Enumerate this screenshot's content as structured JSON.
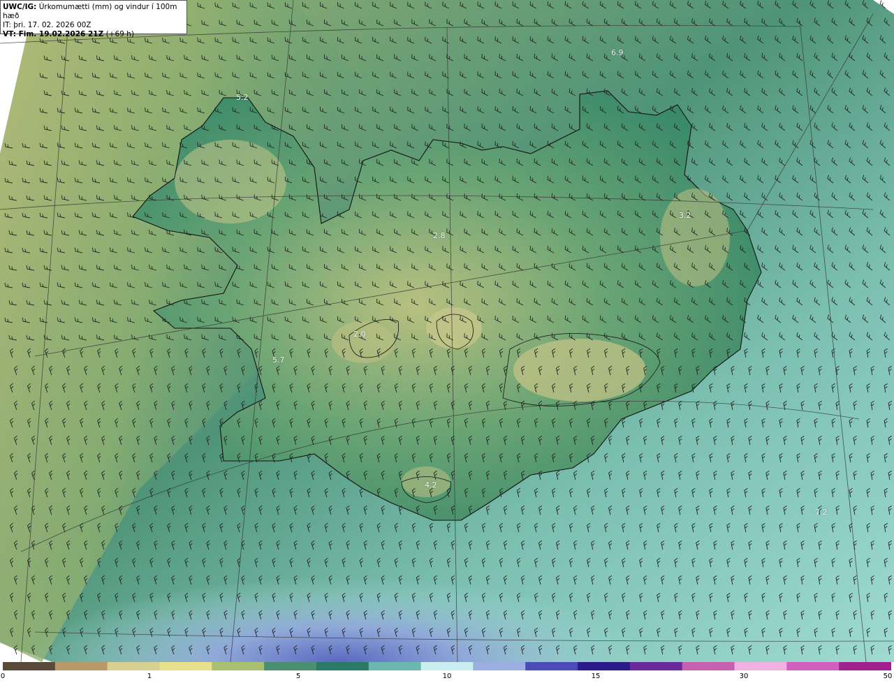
{
  "header": {
    "line1_bold": "UWC/IG:",
    "line1_text": " Úrkomumætti (mm) og vindur í 100m hæð",
    "line2": "IT: þri. 17. 02. 2026 00Z",
    "line3_bold": "VT: Fim. 19.02.2026 21Z",
    "line3_text": " (+69 h)"
  },
  "value_labels": [
    "5.2",
    "6.9",
    "2.8",
    "3.2",
    "2.0",
    "5.7",
    "4.2",
    "7.2"
  ],
  "colorbar": {
    "ticks": [
      "0",
      "1",
      "5",
      "10",
      "15",
      "30",
      "50"
    ],
    "colors": [
      "#5a4a3a",
      "#b89a6a",
      "#d8d090",
      "#e8e08a",
      "#a8c070",
      "#4a9070",
      "#2a7a68",
      "#6ab8b0",
      "#c8eef0",
      "#9aaee0",
      "#4a4ab8",
      "#2a1a8a",
      "#6a2a9a",
      "#c860b0",
      "#f0b0e0",
      "#d060c0",
      "#a02090"
    ]
  },
  "colors": {
    "land_low": "#3f8a6c",
    "land_high": "#c9c98a",
    "ocean_north": "#6fb8a8",
    "ocean_south": "#a6dcd6",
    "west_band": "#8fb070",
    "coastline": "#111111",
    "barb": "#222222"
  }
}
